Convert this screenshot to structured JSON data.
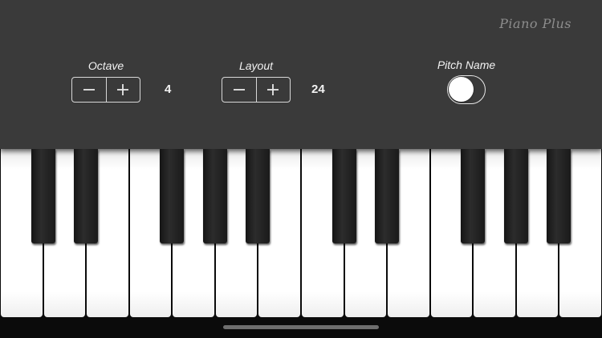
{
  "app": {
    "logo_text": "Piano Plus"
  },
  "controls": {
    "octave": {
      "label": "Octave",
      "value": "4",
      "decrement_icon": "minus-icon",
      "increment_icon": "plus-icon"
    },
    "layout": {
      "label": "Layout",
      "value": "24",
      "decrement_icon": "minus-icon",
      "increment_icon": "plus-icon"
    },
    "pitch_name": {
      "label": "Pitch Name",
      "enabled": false
    }
  },
  "keyboard": {
    "white_key_count": 14,
    "black_key_count": 10
  },
  "colors": {
    "panel": "#3a3a3a",
    "background": "#0b0b0b",
    "text": "#f2f2f2",
    "white_key": "#ffffff",
    "black_key": "#1e1e1e"
  }
}
